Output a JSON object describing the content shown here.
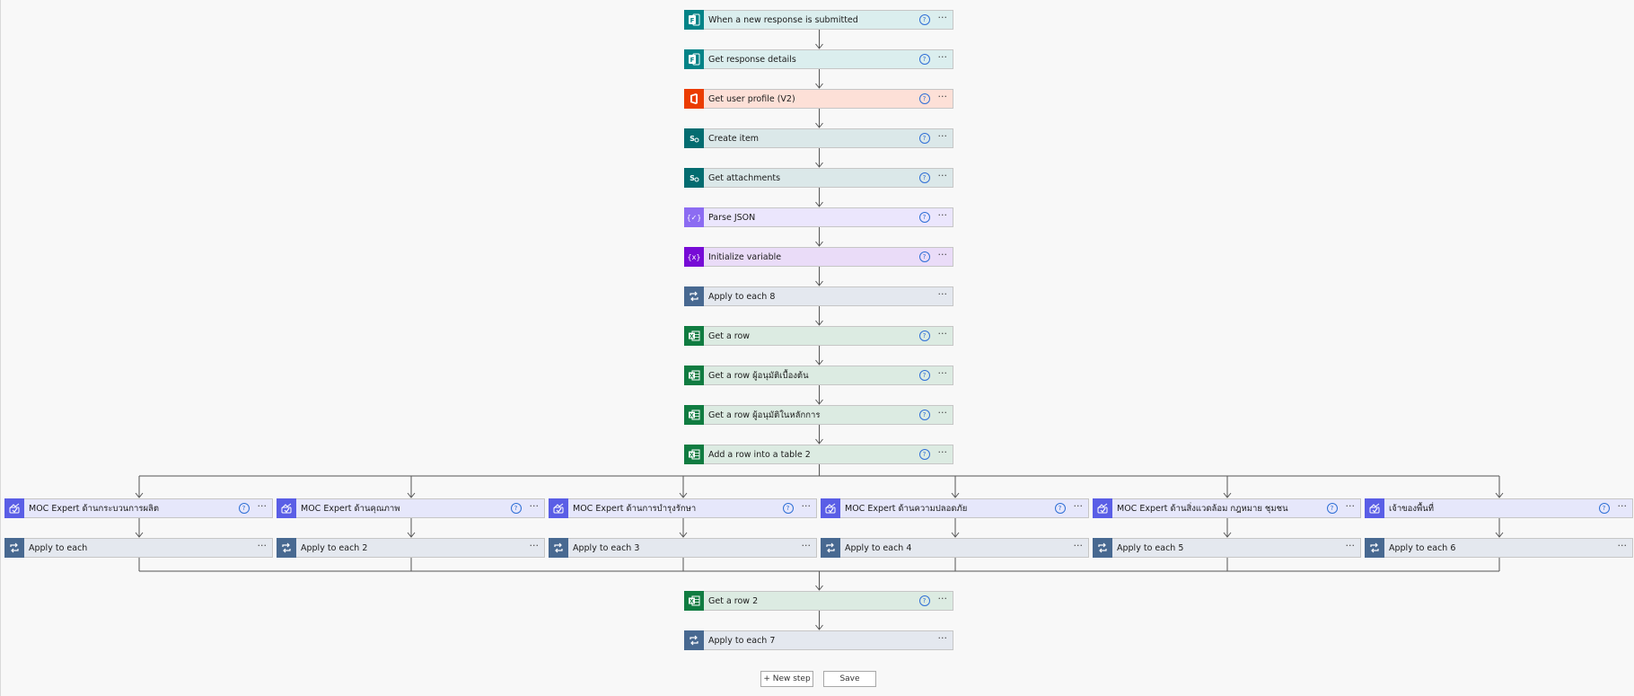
{
  "colors": {
    "forms_bg": "#dbeeee",
    "forms_icon": "#038387",
    "office_bg": "#fde0d7",
    "office_icon": "#eb3c00",
    "sharepoint_bg": "#dbe8e9",
    "sharepoint_icon": "#036c70",
    "json_bg": "#ebe6fd",
    "json_icon": "#8c6cf2",
    "variable_bg": "#eadcf8",
    "variable_icon": "#770bd6",
    "loop_bg": "#e4e8ef",
    "loop_icon": "#486991",
    "excel_bg": "#dcebe2",
    "excel_icon": "#107c41",
    "approval_bg": "#e6e7fb",
    "approval_icon": "#5a5ee6",
    "connector": "#555555"
  },
  "main_steps": [
    {
      "title": "When a new response is submitted",
      "icon": "forms-icon",
      "kind": "forms",
      "help": true
    },
    {
      "title": "Get response details",
      "icon": "forms-icon",
      "kind": "forms",
      "help": true
    },
    {
      "title": "Get user profile (V2)",
      "icon": "office-icon",
      "kind": "office",
      "help": true
    },
    {
      "title": "Create item",
      "icon": "sharepoint-icon",
      "kind": "sharepoint",
      "help": true
    },
    {
      "title": "Get attachments",
      "icon": "sharepoint-icon",
      "kind": "sharepoint",
      "help": true
    },
    {
      "title": "Parse JSON",
      "icon": "json-icon",
      "kind": "json",
      "help": true
    },
    {
      "title": "Initialize variable",
      "icon": "variable-icon",
      "kind": "variable",
      "help": true
    },
    {
      "title": "Apply to each 8",
      "icon": "loop-icon",
      "kind": "loop",
      "help": false
    },
    {
      "title": "Get a row",
      "icon": "excel-icon",
      "kind": "excel",
      "help": true
    },
    {
      "title": "Get a row ผู้อนุมัติเบื้องต้น",
      "icon": "excel-icon",
      "kind": "excel",
      "help": true
    },
    {
      "title": "Get a row ผู้อนุมัติในหลักการ",
      "icon": "excel-icon",
      "kind": "excel",
      "help": true
    },
    {
      "title": "Add a row into a table 2",
      "icon": "excel-icon",
      "kind": "excel",
      "help": true
    }
  ],
  "branches": [
    {
      "approval": "MOC Expert ด้านกระบวนการผลิต",
      "loop": "Apply to each"
    },
    {
      "approval": "MOC Expert ด้านคุณภาพ",
      "loop": "Apply to each 2"
    },
    {
      "approval": "MOC Expert ด้านการบำรุงรักษา",
      "loop": "Apply to each 3"
    },
    {
      "approval": "MOC Expert ด้านความปลอดภัย",
      "loop": "Apply to each 4"
    },
    {
      "approval": "MOC Expert ด้านสิ่งแวดล้อม กฎหมาย ชุมชน",
      "loop": "Apply to each 5"
    },
    {
      "approval": "เจ้าของพื้นที่",
      "loop": "Apply to each 6"
    }
  ],
  "final_steps": [
    {
      "title": "Get a row 2",
      "icon": "excel-icon",
      "kind": "excel",
      "help": true
    },
    {
      "title": "Apply to each 7",
      "icon": "loop-icon",
      "kind": "loop",
      "help": false
    }
  ],
  "buttons": {
    "new_step": "+ New step",
    "save": "Save"
  },
  "help_glyph": "?",
  "more_glyph": "···"
}
